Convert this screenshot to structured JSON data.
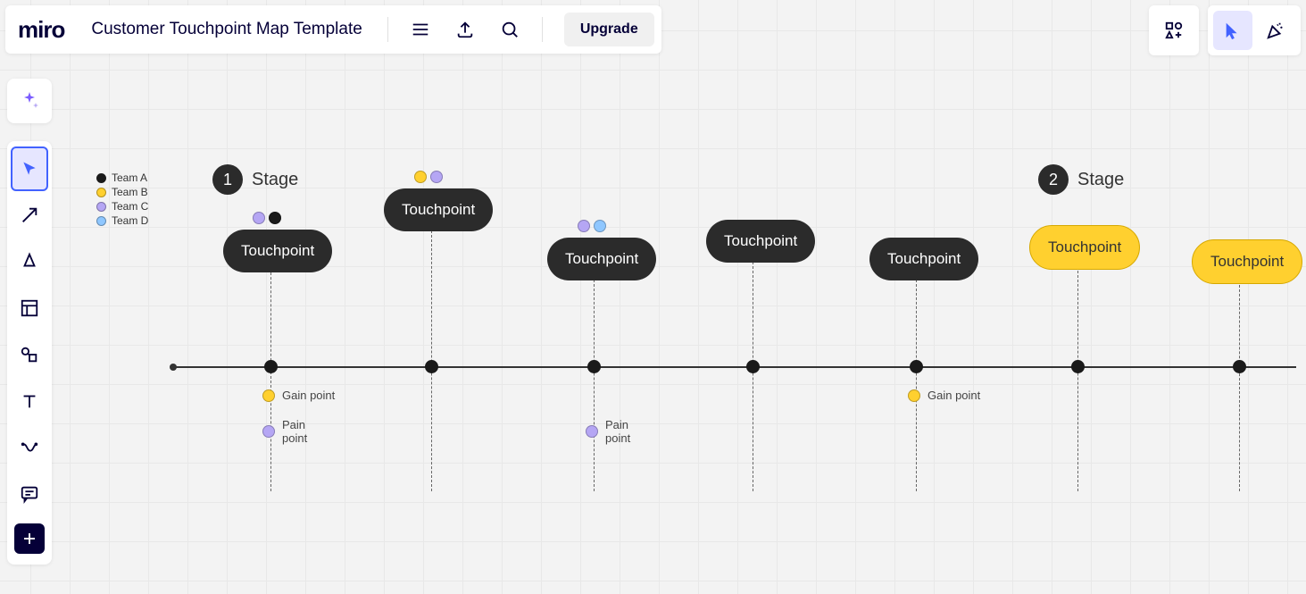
{
  "app": {
    "name": "miro"
  },
  "board": {
    "title": "Customer Touchpoint Map Template"
  },
  "header": {
    "upgrade_label": "Upgrade"
  },
  "toolbar": {
    "tools": [
      "select",
      "line",
      "pen",
      "frame",
      "shapes",
      "text",
      "more",
      "comment",
      "add"
    ]
  },
  "legend": {
    "items": [
      {
        "label": "Team A",
        "color": "dark"
      },
      {
        "label": "Team B",
        "color": "yellow"
      },
      {
        "label": "Team C",
        "color": "purple"
      },
      {
        "label": "Team D",
        "color": "blue"
      }
    ]
  },
  "stages": [
    {
      "number": "1",
      "label": "Stage"
    },
    {
      "number": "2",
      "label": "Stage"
    }
  ],
  "touchpoints": [
    {
      "label": "Touchpoint",
      "variant": "dark"
    },
    {
      "label": "Touchpoint",
      "variant": "dark"
    },
    {
      "label": "Touchpoint",
      "variant": "dark"
    },
    {
      "label": "Touchpoint",
      "variant": "dark"
    },
    {
      "label": "Touchpoint",
      "variant": "dark"
    },
    {
      "label": "Touchpoint",
      "variant": "yellow"
    },
    {
      "label": "Touchpoint",
      "variant": "yellow"
    }
  ],
  "points": {
    "gain_label": "Gain point",
    "pain_label": "Pain point"
  },
  "colors": {
    "dark": "#2b2b2b",
    "yellow": "#ffd02f",
    "purple": "#b5a6f4",
    "blue": "#8fc7ff",
    "accent": "#4262ff"
  }
}
